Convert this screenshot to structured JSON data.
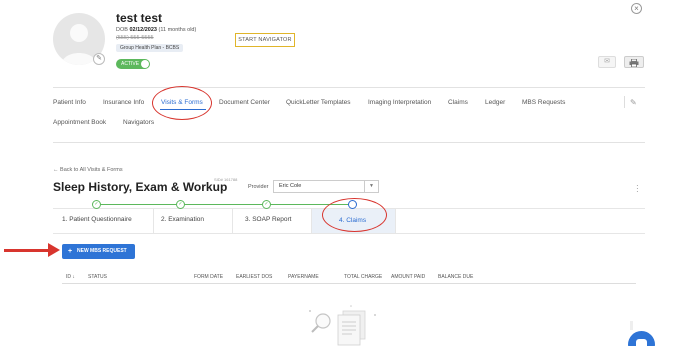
{
  "patient": {
    "name": "test test",
    "dob_label": "DOB",
    "dob": "02/12/2023",
    "age": "(11 months old)",
    "phone": "(555) 555-5555",
    "plan": "Group Health Plan - BCBS",
    "status": "ACTIVE"
  },
  "header": {
    "start_navigator": "START NAVIGATOR",
    "close_glyph": "×",
    "mail_icon": "mail-icon",
    "print_icon": "print-icon"
  },
  "nav": {
    "tabs": [
      {
        "label": "Patient Info"
      },
      {
        "label": "Insurance Info"
      },
      {
        "label": "Visits & Forms"
      },
      {
        "label": "Document Center"
      },
      {
        "label": "QuickLetter Templates"
      },
      {
        "label": "Imaging Interpretation"
      },
      {
        "label": "Claims"
      },
      {
        "label": "Ledger"
      },
      {
        "label": "MBS Requests"
      },
      {
        "label": "Appointment Book"
      },
      {
        "label": "Navigators"
      }
    ],
    "active": "Visits & Forms"
  },
  "visit": {
    "back_link": "←  Back to All Visits & Forms",
    "sid": "SID# 161788",
    "title": "Sleep History, Exam & Workup",
    "provider_label": "Provider",
    "provider_value": "Eric Cole"
  },
  "steps": [
    {
      "label": "1. Patient Questionnaire",
      "state": "done"
    },
    {
      "label": "2. Examination",
      "state": "done"
    },
    {
      "label": "3. SOAP Report",
      "state": "done"
    },
    {
      "label": "4. Claims",
      "state": "current"
    }
  ],
  "claims": {
    "new_button": "NEW MBS REQUEST",
    "columns": [
      "ID",
      "STATUS",
      "FORM DATE",
      "EARLIEST DOS",
      "PAYERNAME",
      "TOTAL CHARGE",
      "AMOUNT PAID",
      "BALANCE DUE"
    ]
  },
  "colors": {
    "accent": "#2e74d6",
    "success": "#5cb85c",
    "annotation": "#d8352e",
    "navigator_border": "#e0b52a"
  }
}
